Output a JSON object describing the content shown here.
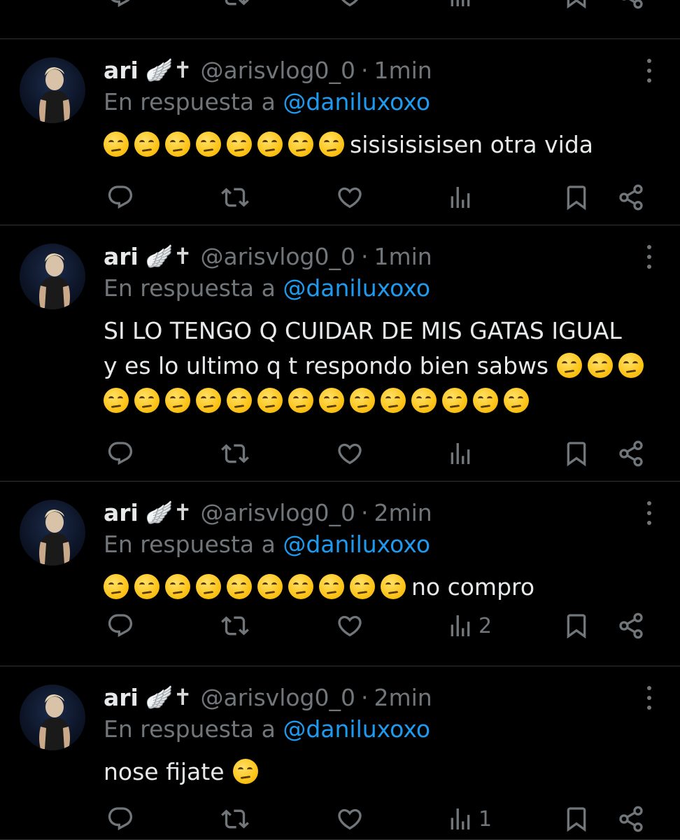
{
  "tweets": [
    {
      "name": "ari",
      "badge": "🪽✝",
      "handle": "@arisvlog0_0",
      "dot": "·",
      "time": "1min",
      "reply_prefix": "En respuesta a",
      "reply_to": "@daniluxoxo",
      "lines": [
        {
          "emoji_before": 8,
          "text": "sisisisisisen otra vida",
          "emoji_after": 0
        }
      ],
      "views": ""
    },
    {
      "name": "ari",
      "badge": "🪽✝",
      "handle": "@arisvlog0_0",
      "dot": "·",
      "time": "1min",
      "reply_prefix": "En respuesta a",
      "reply_to": "@daniluxoxo",
      "lines": [
        {
          "emoji_before": 0,
          "text": "SI LO TENGO Q CUIDAR DE MIS GATAS IGUAL",
          "emoji_after": 0
        },
        {
          "emoji_before": 0,
          "text": "y es lo ultimo q t respondo bien sabws",
          "emoji_after": 3
        },
        {
          "emoji_before": 14,
          "text": "",
          "emoji_after": 0
        }
      ],
      "views": ""
    },
    {
      "name": "ari",
      "badge": "🪽✝",
      "handle": "@arisvlog0_0",
      "dot": "·",
      "time": "2min",
      "reply_prefix": "En respuesta a",
      "reply_to": "@daniluxoxo",
      "lines": [
        {
          "emoji_before": 10,
          "text": "no compro",
          "emoji_after": 0
        }
      ],
      "views": "2"
    },
    {
      "name": "ari",
      "badge": "🪽✝",
      "handle": "@arisvlog0_0",
      "dot": "·",
      "time": "2min",
      "reply_prefix": "En respuesta a",
      "reply_to": "@daniluxoxo",
      "lines": [
        {
          "emoji_before": 0,
          "text": "nose fijate",
          "emoji_after": 1
        }
      ],
      "views": "1"
    }
  ],
  "icons": {
    "reply": "reply-icon",
    "retweet": "retweet-icon",
    "like": "heart-icon",
    "views": "views-icon",
    "bookmark": "bookmark-icon",
    "share": "share-icon",
    "emoji": "unamused-face-emoji"
  },
  "colors": {
    "background": "#000000",
    "text": "#e7e9ea",
    "muted": "#71767b",
    "link": "#1d9bf0",
    "divider": "#2f3336"
  }
}
